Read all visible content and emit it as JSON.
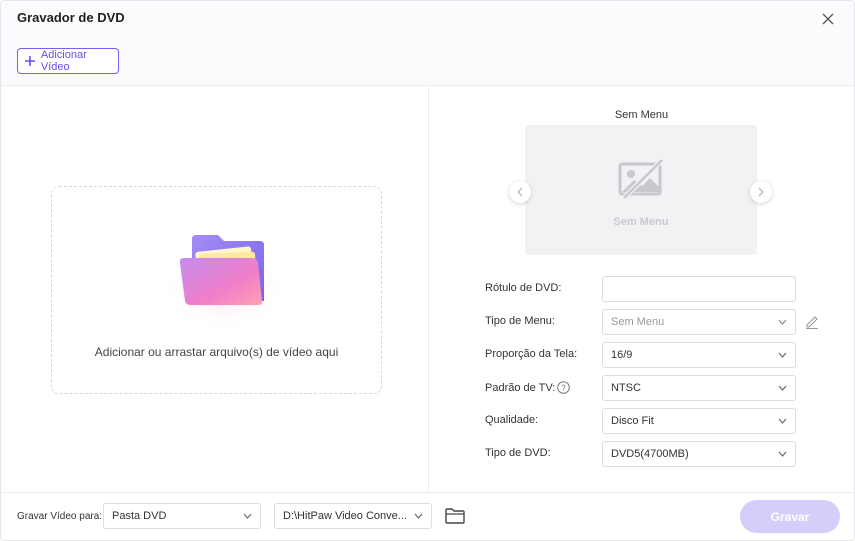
{
  "window": {
    "title": "Gravador de DVD"
  },
  "toolbar": {
    "add_video_label": "Adicionar Vídeo"
  },
  "dropzone": {
    "hint": "Adicionar ou arrastar arquivo(s) de vídeo aqui"
  },
  "preview": {
    "title": "Sem Menu",
    "placeholder_label": "Sem Menu"
  },
  "settings": {
    "dvd_label": {
      "label": "Rótulo de DVD:",
      "value": ""
    },
    "menu_type": {
      "label": "Tipo de Menu:",
      "value": "Sem Menu"
    },
    "aspect_ratio": {
      "label": "Proporção da Tela:",
      "value": "16/9"
    },
    "tv_standard": {
      "label": "Padrão de TV:",
      "value": "NTSC"
    },
    "quality": {
      "label": "Qualidade:",
      "value": "Disco Fit"
    },
    "dvd_type": {
      "label": "Tipo de DVD:",
      "value": "DVD5(4700MB)"
    }
  },
  "footer": {
    "save_to_label": "Gravar Vídeo para:",
    "output_type": "Pasta DVD",
    "output_path": "D:\\HitPaw Video Conve...",
    "burn_label": "Gravar"
  },
  "colors": {
    "accent": "#7c5cf5",
    "burn_disabled": "#d6cdfb"
  },
  "icons": [
    "close-icon",
    "plus-icon",
    "folder-illustration-icon",
    "no-image-icon",
    "chevron-left-icon",
    "chevron-right-icon",
    "chevron-down-icon",
    "help-icon",
    "edit-icon",
    "folder-icon"
  ]
}
